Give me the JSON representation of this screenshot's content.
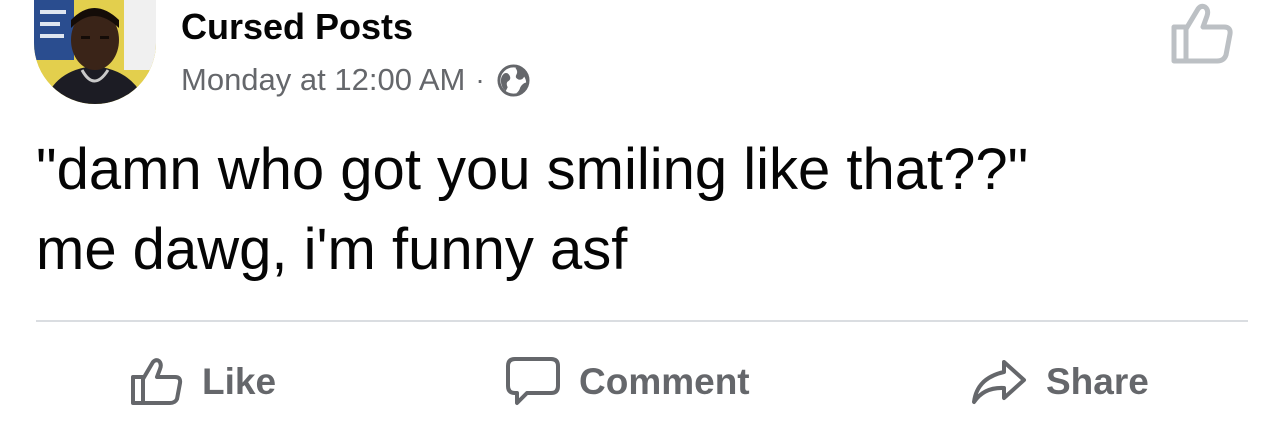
{
  "post": {
    "page_name": "Cursed Posts",
    "timestamp": "Monday at 12:00 AM",
    "separator": "·",
    "audience_icon": "globe-icon",
    "text_lines": [
      "\"damn who got you smiling like that??\"",
      "me dawg, i'm funny asf"
    ]
  },
  "actions": {
    "like": {
      "label": "Like",
      "icon": "thumbs-up-icon"
    },
    "comment": {
      "label": "Comment",
      "icon": "comment-bubble-icon"
    },
    "share": {
      "label": "Share",
      "icon": "share-arrow-icon"
    }
  },
  "colors": {
    "text_primary": "#050505",
    "text_secondary": "#65676b",
    "divider": "#dadde1",
    "icon_gray": "#65676b"
  }
}
